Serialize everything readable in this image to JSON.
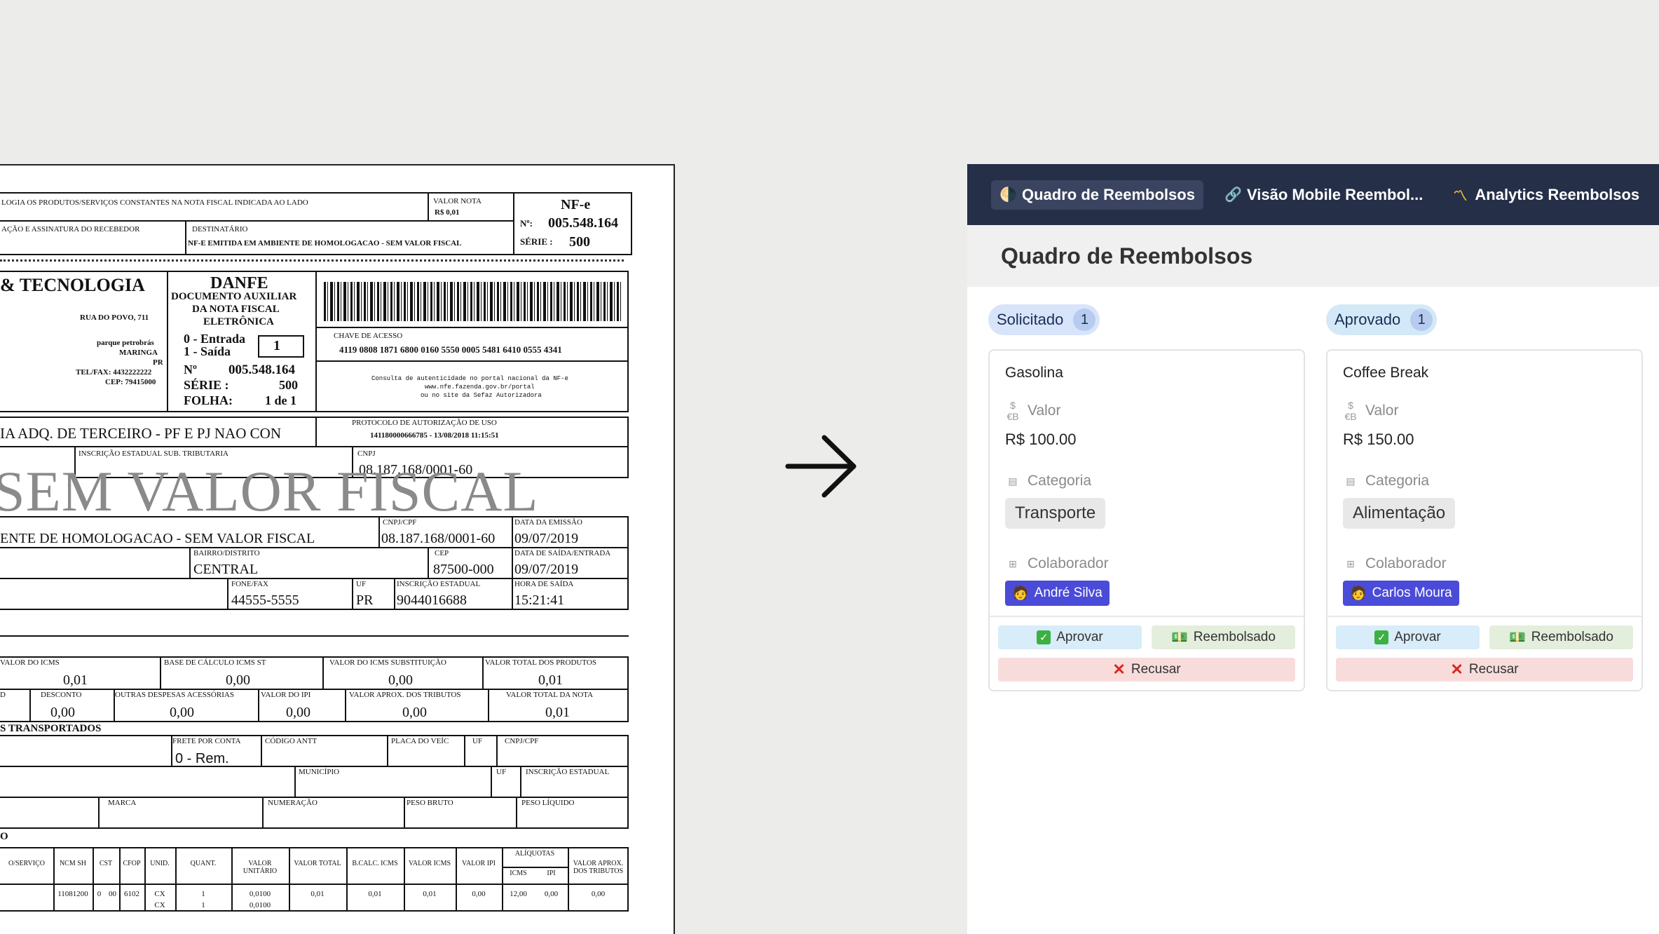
{
  "document": {
    "row1": {
      "receipt_text": "LOGIA OS PRODUTOS/SERVIÇOS CONSTANTES NA NOTA FISCAL INDICADA AO LADO",
      "valor_nota_label": "VALOR NOTA",
      "valor_nota_value": "R$ 0,01",
      "nfe_title": "NF-e",
      "nfe_no_label": "Nº:",
      "nfe_no_value": "005.548.164",
      "serie_label": "SÉRIE :",
      "serie_value": "500",
      "assinatura_label": "AÇÃO E ASSINATURA DO RECEBEDOR",
      "destinatario_label": "DESTINATÁRIO",
      "destinatario_value": "NF-E EMITIDA EM AMBIENTE DE HOMOLOGACAO - SEM VALOR FISCAL"
    },
    "emitente": {
      "name": "& TECNOLOGIA",
      "street": "RUA DO POVO, 711",
      "district": "parque petrobrás",
      "city": "MARINGA",
      "state": "PR",
      "phone": "TEL/FAX: 4432222222",
      "cep": "CEP: 79415000"
    },
    "danfe": {
      "title": "DANFE",
      "line1": "DOCUMENTO AUXILIAR",
      "line2": "DA NOTA FISCAL",
      "line3": "ELETRÔNICA",
      "entrada": "0 - Entrada",
      "saida": "1 - Saída",
      "tipo": "1",
      "no_label": "Nº",
      "no_value": "005.548.164",
      "serie_label": "SÉRIE :",
      "serie_value": "500",
      "folha_label": "FOLHA:",
      "folha_value": "1 de 1"
    },
    "chave_label": "CHAVE DE ACESSO",
    "chave_value": "4119 0808 1871 6800 0160 5550 0005 5481 6410 0555 4341",
    "consulta_1": "Consulta de autenticidade no portal nacional da NF-e",
    "consulta_2": "www.nfe.fazenda.gov.br/portal",
    "consulta_3": "ou no site da Sefaz Autorizadora",
    "natureza_value": "IA ADQ. DE TERCEIRO - PF E PJ NAO CON",
    "protocolo_label": "PROTOCOLO DE AUTORIZAÇÃO DE USO",
    "protocolo_value": "141180000666785 - 13/08/2018 11:15:51",
    "ie_sub_label": "INSCRIÇÃO ESTADUAL SUB. TRIBUTARIA",
    "cnpj_label": "CNPJ",
    "cnpj_value": "08.187.168/0001-60",
    "watermark": "SEM VALOR FISCAL",
    "dest": {
      "name": "ENTE DE HOMOLOGACAO - SEM VALOR FISCAL",
      "cnpj_label": "CNPJ/CPF",
      "cnpj_value": "08.187.168/0001-60",
      "emissao_label": "DATA DA EMISSÃO",
      "emissao_value": "09/07/2019",
      "bairro_label": "BAIRRO/DISTRITO",
      "bairro_value": "CENTRAL",
      "cep_label": "CEP",
      "cep_value": "87500-000",
      "saida_label": "DATA DE SAÍDA/ENTRADA",
      "saida_value": "09/07/2019",
      "fone_label": "FONE/FAX",
      "fone_value": "44555-5555",
      "uf_label": "UF",
      "uf_value": "PR",
      "ie_label": "INSCRIÇÃO ESTADUAL",
      "ie_value": "9044016688",
      "hora_label": "HORA DE SAÍDA",
      "hora_value": "15:21:41"
    },
    "imposto": {
      "icms_label": "VALOR DO ICMS",
      "icms_value": "0,01",
      "base_st_label": "BASE DE CÁLCULO ICMS ST",
      "base_st_value": "0,00",
      "icms_st_label": "VALOR DO ICMS SUBSTITUIÇÃO",
      "icms_st_value": "0,00",
      "total_prod_label": "VALOR TOTAL DOS PRODUTOS",
      "total_prod_value": "0,01",
      "d_label": "D",
      "desconto_label": "DESCONTO",
      "desconto_value": "0,00",
      "outras_label": "OUTRAS DESPESAS ACESSÓRIAS",
      "outras_value": "0,00",
      "ipi_label": "VALOR DO IPI",
      "ipi_value": "0,00",
      "aprox_label": "VALOR APROX. DOS TRIBUTOS",
      "aprox_value": "0,00",
      "total_nota_label": "VALOR TOTAL DA NOTA",
      "total_nota_value": "0,01"
    },
    "transp": {
      "title": "S TRANSPORTADOS",
      "frete_label": "FRETE POR CONTA",
      "frete_value": "0 - Rem.",
      "antt_label": "CÓDIGO ANTT",
      "placa_label": "PLACA DO VEÍC",
      "uf_label": "UF",
      "cnpj_label": "CNPJ/CPF",
      "municipio_label": "MUNICÍPIO",
      "uf2_label": "UF",
      "ie_label": "INSCRIÇÃO ESTADUAL",
      "marca_label": "MARCA",
      "numeracao_label": "NUMERAÇÃO",
      "peso_bruto_label": "PESO BRUTO",
      "peso_liquido_label": "PESO LÍQUIDO"
    },
    "items_title": "O",
    "items_headers": [
      "O/SERVIÇO",
      "NCM SH",
      "CST",
      "CFOP",
      "UNID.",
      "QUANT.",
      "VALOR UNITÁRIO",
      "VALOR TOTAL",
      "B.CALC. ICMS",
      "VALOR ICMS",
      "VALOR IPI",
      "ALÍQUOTAS",
      "VALOR APROX. DOS TRIBUTOS"
    ],
    "aliquotas_sub": [
      "ICMS",
      "IPI"
    ],
    "item_row": [
      "11081200",
      "0",
      "00",
      "6102",
      "CX",
      "1",
      "0,0100",
      "0,01",
      "0,01",
      "0,01",
      "0,00",
      "12,00",
      "0,00",
      "0,00"
    ],
    "item_row2": [
      "CX",
      "1",
      "0,0100"
    ]
  },
  "app": {
    "tabs": [
      {
        "icon": "🌗",
        "label": "Quadro de Reembolsos"
      },
      {
        "icon": "🔗",
        "label": "Visão Mobile Reembol..."
      },
      {
        "icon": "〽",
        "label": "Analytics Reembolsos"
      },
      {
        "icon": "💰",
        "label": ""
      }
    ],
    "page_title": "Quadro de Reembolsos",
    "columns": [
      {
        "status": "Solicitado",
        "count": "1",
        "card": {
          "title": "Gasolina",
          "valor_icon": "$€B",
          "valor_label": "Valor",
          "valor_value": "R$ 100.00",
          "categoria_label": "Categoria",
          "categoria_value": "Transporte",
          "colaborador_label": "Colaborador",
          "colaborador_value": "André Silva",
          "approve": "Aprovar",
          "refunded": "Reembolsado",
          "reject": "Recusar"
        }
      },
      {
        "status": "Aprovado",
        "count": "1",
        "card": {
          "title": "Coffee Break",
          "valor_icon": "$€B",
          "valor_label": "Valor",
          "valor_value": "R$ 150.00",
          "categoria_label": "Categoria",
          "categoria_value": "Alimentação",
          "colaborador_label": "Colaborador",
          "colaborador_value": "Carlos Moura",
          "approve": "Aprovar",
          "refunded": "Reembolsado",
          "reject": "Recusar"
        }
      }
    ],
    "colors": {
      "tabbar": "#252f48",
      "accent_person": "#4a4bd8",
      "approve_bg": "#d8ecf9",
      "refunded_bg": "#e3eedc",
      "reject_bg": "#f8dcdc"
    }
  }
}
